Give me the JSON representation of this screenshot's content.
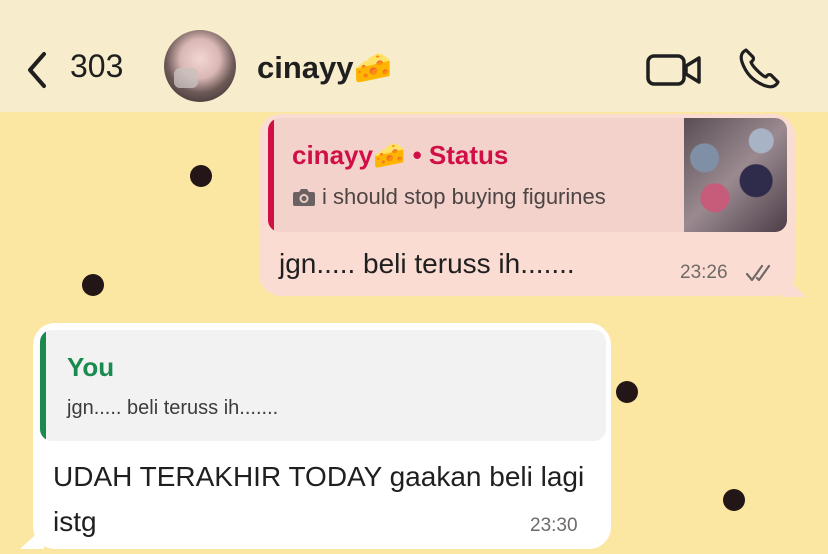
{
  "header": {
    "back_count": "303",
    "contact_name": "cinayy🧀",
    "icons": [
      "back-chevron-icon",
      "video-call-icon",
      "phone-call-icon"
    ]
  },
  "outgoing": {
    "quote_name": "cinayy🧀",
    "quote_source": "• Status",
    "quote_text": "i should stop buying figurines",
    "message": "jgn..... beli teruss ih.......",
    "time": "23:26",
    "read_ticks": "read-double-check-icon"
  },
  "incoming": {
    "quote_name": "You",
    "quote_text": "jgn..... beli teruss ih.......",
    "message": "UDAH TERAKHIR TODAY gaakan beli lagi istg",
    "time": "23:30"
  },
  "colors": {
    "header_bg": "#f7eccb",
    "chat_bg": "#fbe7a1",
    "outgoing_bubble": "#fbdcd3",
    "status_accent": "#d10f47",
    "you_accent": "#1a8a4f"
  }
}
